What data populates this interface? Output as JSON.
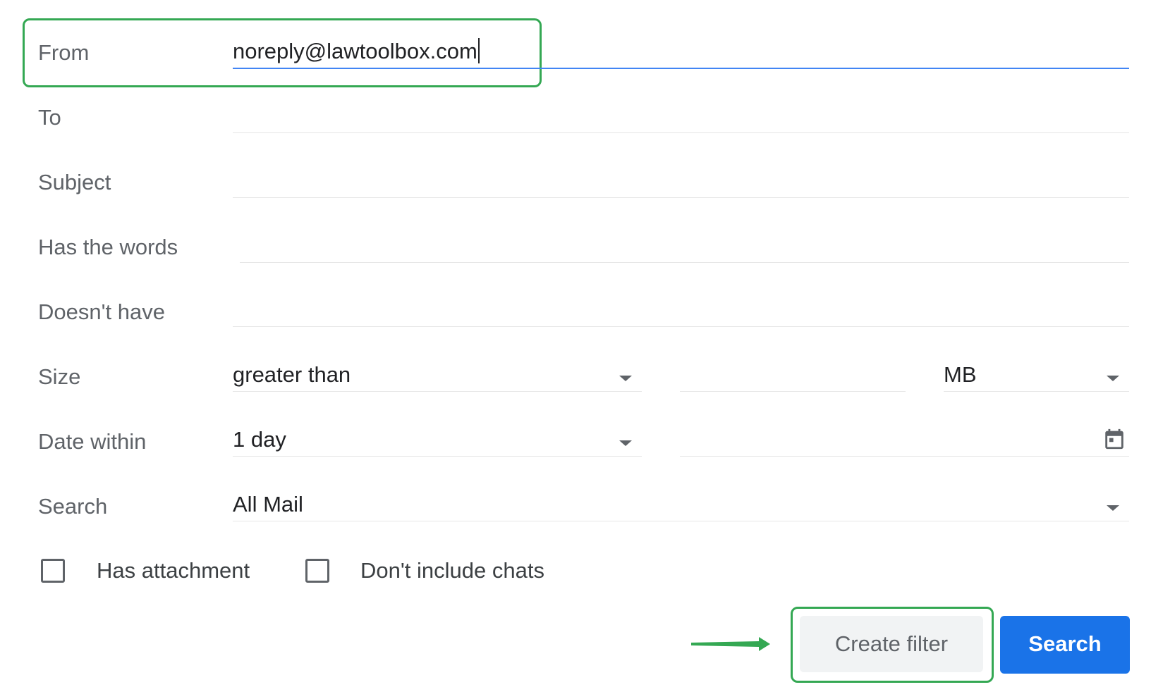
{
  "form": {
    "from": {
      "label": "From",
      "value": "noreply@lawtoolbox.com"
    },
    "to": {
      "label": "To",
      "value": ""
    },
    "subject": {
      "label": "Subject",
      "value": ""
    },
    "has_words": {
      "label": "Has the words",
      "value": ""
    },
    "doesnt_have": {
      "label": "Doesn't have",
      "value": ""
    },
    "size": {
      "label": "Size",
      "operator": "greater than",
      "amount": "",
      "unit": "MB"
    },
    "date_within": {
      "label": "Date within",
      "value": "1 day",
      "date": ""
    },
    "search": {
      "label": "Search",
      "value": "All Mail"
    },
    "has_attachment": {
      "label": "Has attachment",
      "checked": false
    },
    "dont_include_chats": {
      "label": "Don't include chats",
      "checked": false
    }
  },
  "buttons": {
    "create_filter": "Create filter",
    "search": "Search"
  },
  "colors": {
    "highlight": "#34a853",
    "focus_underline": "#4285f4",
    "primary_button": "#1a73e8",
    "secondary_button": "#f1f3f4"
  },
  "icons": {
    "dropdown": "chevron-down-icon",
    "calendar": "calendar-icon",
    "annotation_arrow": "arrow-right-icon"
  }
}
